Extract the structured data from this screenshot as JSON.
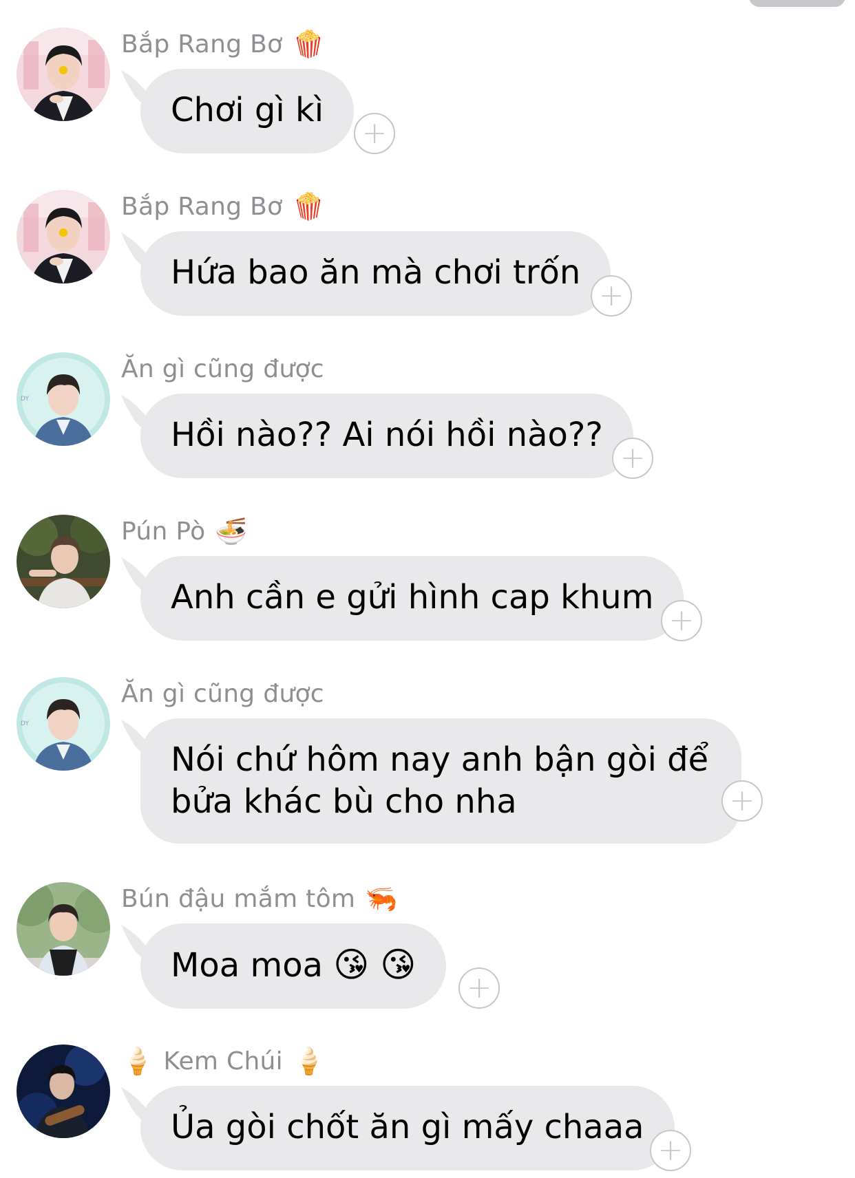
{
  "messages": [
    {
      "sender": "Bắp Rang Bơ",
      "sender_prefix_emoji": "",
      "sender_suffix_emoji": "🍿",
      "lines": [
        "Chơi gì kì"
      ],
      "avatar_icon": "avatar-photo-icon"
    },
    {
      "sender": "Bắp Rang Bơ",
      "sender_prefix_emoji": "",
      "sender_suffix_emoji": "🍿",
      "lines": [
        "Hứa bao ăn mà chơi trốn"
      ],
      "avatar_icon": "avatar-photo-icon"
    },
    {
      "sender": "Ăn gì cũng được",
      "sender_prefix_emoji": "",
      "sender_suffix_emoji": "",
      "lines": [
        "Hồi nào?? Ai nói hồi nào??"
      ],
      "avatar_icon": "avatar-photo-icon"
    },
    {
      "sender": "Pún Pò",
      "sender_prefix_emoji": "",
      "sender_suffix_emoji": "🍜",
      "lines": [
        "Anh cần e gửi hình cap khum"
      ],
      "avatar_icon": "avatar-photo-icon"
    },
    {
      "sender": "Ăn gì cũng được",
      "sender_prefix_emoji": "",
      "sender_suffix_emoji": "",
      "lines": [
        "Nói chứ hôm nay anh bận gòi để",
        "bửa khác bù cho nha"
      ],
      "avatar_icon": "avatar-photo-icon"
    },
    {
      "sender": "Bún đậu mắm tôm",
      "sender_prefix_emoji": "",
      "sender_suffix_emoji": "🦐",
      "lines": [
        "Moa moa"
      ],
      "message_emoji": "😘 😘",
      "avatar_icon": "avatar-photo-icon"
    },
    {
      "sender": "Kem Chúi",
      "sender_prefix_emoji": "🍦",
      "sender_suffix_emoji": "🍦",
      "lines": [
        "Ủa gòi chốt ăn gì mấy chaaa"
      ],
      "avatar_icon": "avatar-photo-icon"
    }
  ],
  "react_button_symbol": "+",
  "colors": {
    "bubble": "#e9e9eb",
    "sender_text": "#8e8e93",
    "react_border": "#c7c7cc"
  }
}
